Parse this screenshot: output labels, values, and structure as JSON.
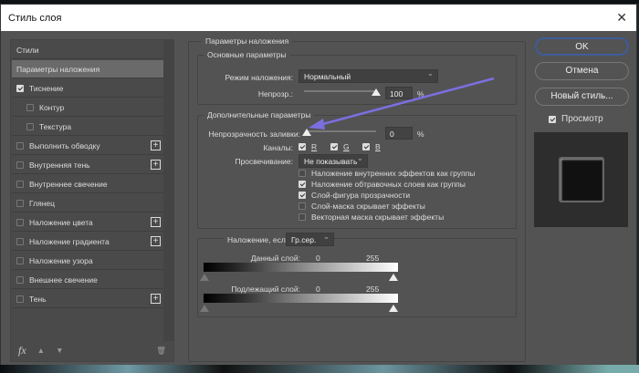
{
  "window": {
    "title": "Стиль слоя"
  },
  "styles_list": [
    {
      "label": "Стили",
      "checkbox": false,
      "selected": false
    },
    {
      "label": "Параметры наложения",
      "checkbox": false,
      "selected": true
    },
    {
      "label": "Тиснение",
      "checkbox": true,
      "checked": true
    },
    {
      "label": "Контур",
      "checkbox": true,
      "checked": false,
      "indent": true
    },
    {
      "label": "Текстура",
      "checkbox": true,
      "checked": false,
      "indent": true
    },
    {
      "label": "Выполнить обводку",
      "checkbox": true,
      "checked": false,
      "plus": true
    },
    {
      "label": "Внутренняя тень",
      "checkbox": true,
      "checked": false,
      "plus": true
    },
    {
      "label": "Внутреннее свечение",
      "checkbox": true,
      "checked": false
    },
    {
      "label": "Глянец",
      "checkbox": true,
      "checked": false
    },
    {
      "label": "Наложение цвета",
      "checkbox": true,
      "checked": false,
      "plus": true
    },
    {
      "label": "Наложение градиента",
      "checkbox": true,
      "checked": false,
      "plus": true
    },
    {
      "label": "Наложение узора",
      "checkbox": true,
      "checked": false
    },
    {
      "label": "Внешнее свечение",
      "checkbox": true,
      "checked": false
    },
    {
      "label": "Тень",
      "checkbox": true,
      "checked": false,
      "plus": true
    }
  ],
  "footer": {
    "fx": "fx"
  },
  "blending": {
    "title": "Параметры наложения",
    "general": {
      "title": "Основные параметры",
      "mode_label": "Режим наложения:",
      "mode_value": "Нормальный",
      "opacity_label": "Непрозр.:",
      "opacity_value": "100",
      "opacity_unit": "%"
    },
    "advanced": {
      "title": "Дополнительные параметры",
      "fill_label": "Непрозрачность заливки:",
      "fill_value": "0",
      "fill_unit": "%",
      "channels_label": "Каналы:",
      "channels": [
        "R",
        "G",
        "B"
      ],
      "knockout_label": "Просвечивание:",
      "knockout_value": "Не показывать",
      "options": [
        {
          "label": "Наложение внутренних эффектов как группы",
          "checked": false
        },
        {
          "label": "Наложение обтравочных слоев как группы",
          "checked": true
        },
        {
          "label": "Слой-фигура прозрачности",
          "checked": true
        },
        {
          "label": "Слой-маска скрывает эффекты",
          "checked": false
        },
        {
          "label": "Векторная маска скрывает эффекты",
          "checked": false
        }
      ]
    },
    "blend_if": {
      "label": "Наложение, если:",
      "value": "Гр.сер.",
      "this_layer": "Данный слой:",
      "underlying": "Подлежащий слой:",
      "min": "0",
      "max": "255"
    }
  },
  "buttons": {
    "ok": "OK",
    "cancel": "Отмена",
    "new_style": "Новый стиль...",
    "preview": "Просмотр"
  },
  "colors": {
    "dialog": "#535353",
    "arrow": "#7b6fe0",
    "ok_border": "#3e5c99"
  }
}
